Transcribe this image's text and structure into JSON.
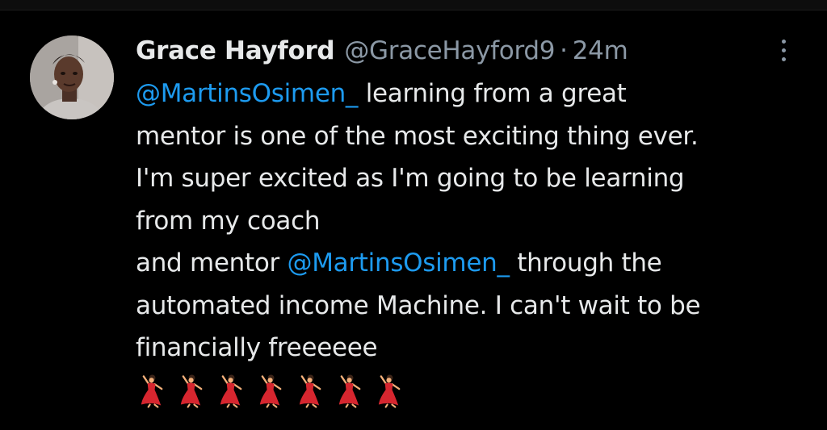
{
  "tweet": {
    "author_name": "Grace Hayford",
    "author_handle": "@GraceHayford9",
    "separator": "·",
    "timestamp": "24m",
    "lines": [
      {
        "parts": [
          {
            "type": "mention",
            "text": "@MartinsOsimen_"
          },
          {
            "type": "text",
            "text": " learning from a great"
          }
        ]
      },
      {
        "parts": [
          {
            "type": "text",
            "text": "mentor is one of the most exciting thing ever."
          }
        ]
      },
      {
        "parts": [
          {
            "type": "text",
            "text": "I'm super excited as I'm going to be learning"
          }
        ]
      },
      {
        "parts": [
          {
            "type": "text",
            "text": "from my coach"
          }
        ]
      },
      {
        "parts": [
          {
            "type": "text",
            "text": "and mentor "
          },
          {
            "type": "mention",
            "text": "@MartinsOsimen_"
          },
          {
            "type": "text",
            "text": " through the"
          }
        ]
      },
      {
        "parts": [
          {
            "type": "text",
            "text": "automated income Machine. I can't wait to be"
          }
        ]
      },
      {
        "parts": [
          {
            "type": "text",
            "text": "financially freeeeee"
          }
        ]
      }
    ],
    "emojis": [
      "dancer-emoji",
      "dancer-emoji",
      "dancer-emoji",
      "dancer-emoji",
      "dancer-emoji",
      "dancer-emoji",
      "dancer-emoji"
    ]
  },
  "colors": {
    "background": "#000000",
    "text": "#e7e9ea",
    "secondary": "#8b98a5",
    "mention": "#1d9bf0",
    "emoji_red": "#d6262f"
  },
  "icons": {
    "more": "more-vertical-icon",
    "avatar": "user-avatar"
  }
}
